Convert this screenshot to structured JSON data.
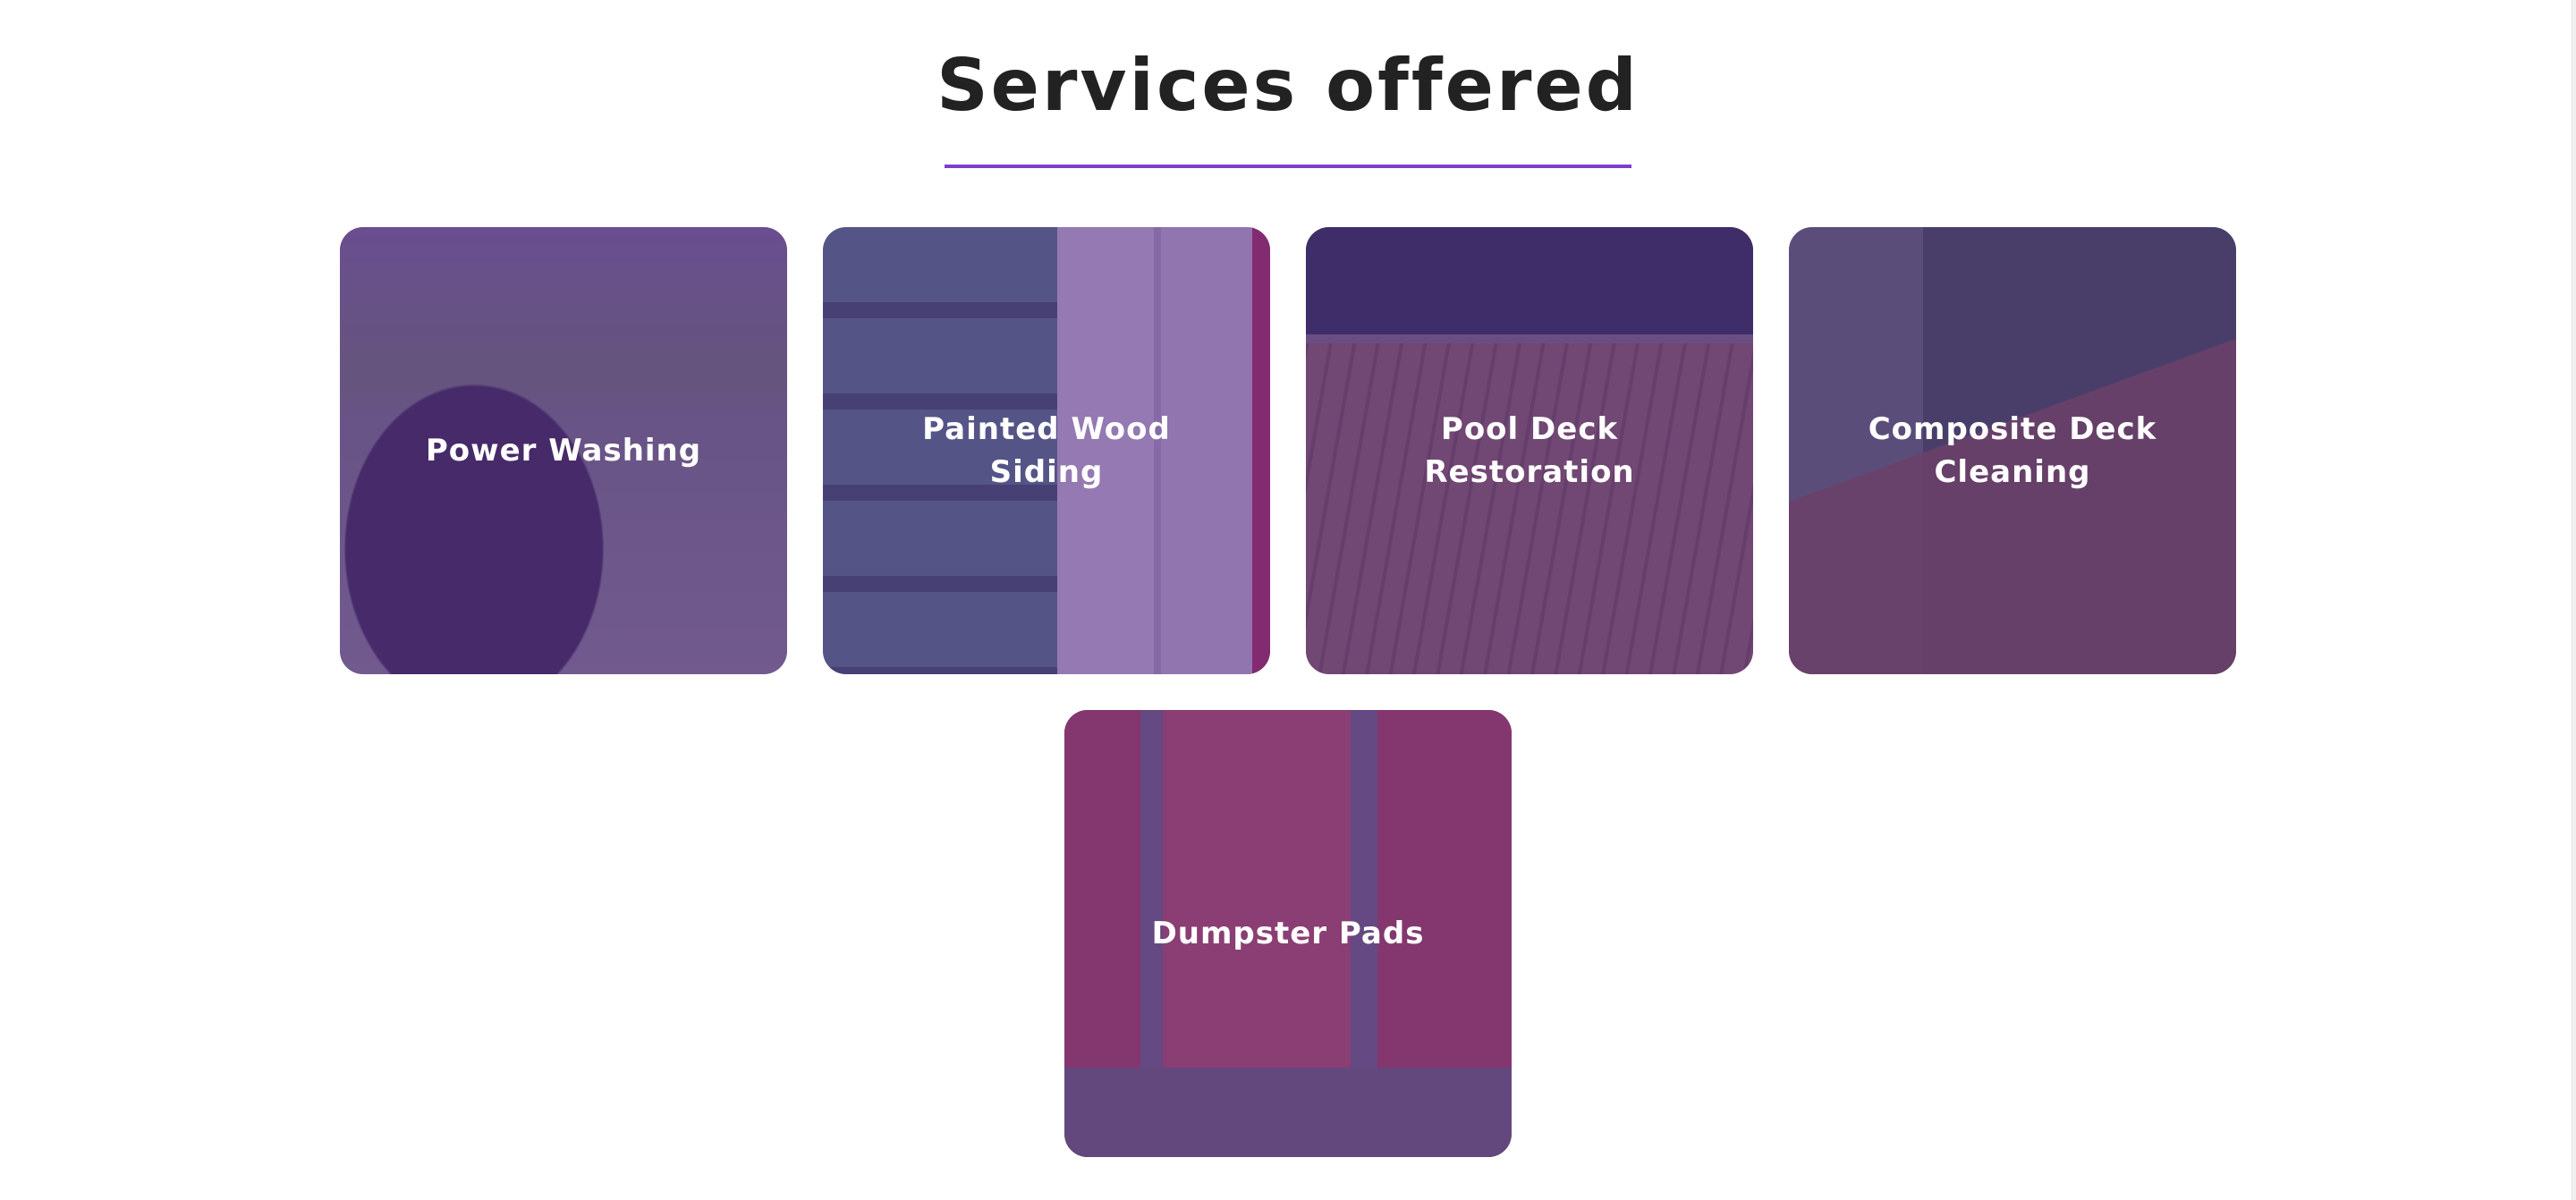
{
  "section": {
    "title": "Services offered",
    "accent_color": "#7b3fc9"
  },
  "services": [
    {
      "label": "Power Washing"
    },
    {
      "label": "Painted Wood\nSiding"
    },
    {
      "label": "Pool Deck\nRestoration"
    },
    {
      "label": "Composite Deck\nCleaning"
    },
    {
      "label": "Dumpster Pads"
    }
  ]
}
